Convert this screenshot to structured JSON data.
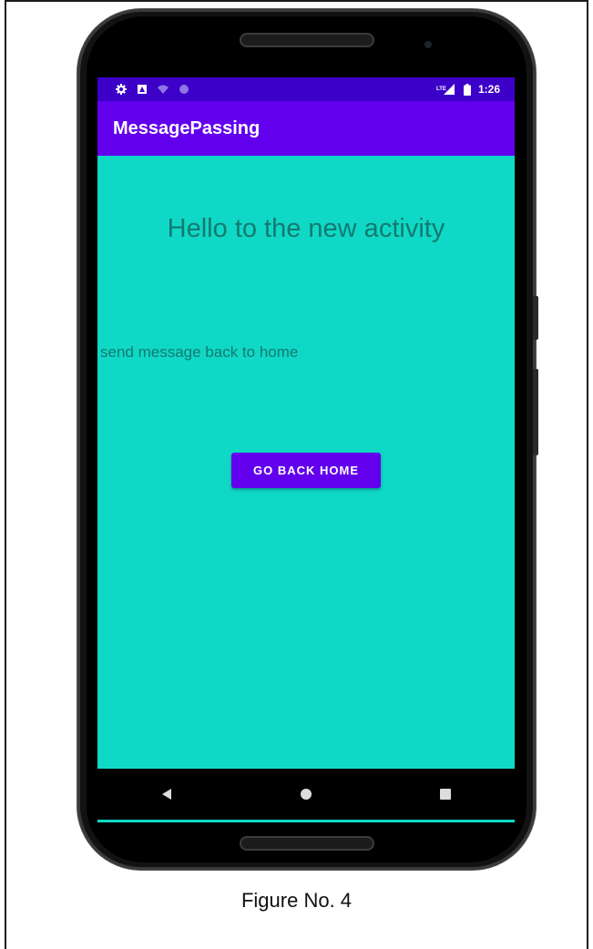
{
  "status_bar": {
    "time": "1:26",
    "network_label": "LTE",
    "icons": [
      "gear-icon",
      "sim-icon",
      "wifi-icon",
      "circle-icon",
      "signal-icon",
      "battery-icon"
    ]
  },
  "app_bar": {
    "title": "MessagePassing"
  },
  "content": {
    "heading": "Hello to the new activity",
    "message": "send message back to home",
    "button_label": "GO BACK HOME"
  },
  "nav_bar": {
    "icons": [
      "back-icon",
      "home-icon",
      "recents-icon"
    ]
  },
  "caption": "Figure No. 4",
  "colors": {
    "status_bar": "#3c00c8",
    "app_bar": "#6200ee",
    "background": "#10d8c6",
    "text": "#137a70",
    "button": "#6200ee"
  }
}
